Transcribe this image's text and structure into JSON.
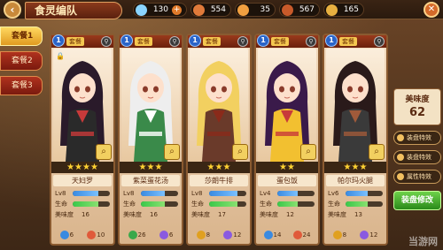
{
  "header": {
    "title": "食灵编队",
    "back_icon": "back-arrow-icon",
    "close_icon": "close-icon"
  },
  "resources": [
    {
      "icon": "diamond-icon",
      "value": "130",
      "color": "#8ad4ff",
      "has_plus": true
    },
    {
      "icon": "food-icon",
      "value": "554",
      "color": "#e07a3a",
      "has_plus": false
    },
    {
      "icon": "chicken-icon",
      "value": "35",
      "color": "#f2a040",
      "has_plus": false
    },
    {
      "icon": "drumstick-icon",
      "value": "567",
      "color": "#c85a2a",
      "has_plus": false
    },
    {
      "icon": "bread-icon",
      "value": "165",
      "color": "#e8b040",
      "has_plus": false
    }
  ],
  "tabs": [
    {
      "label": "套餐1",
      "active": true
    },
    {
      "label": "套餐2",
      "active": false
    },
    {
      "label": "套餐3",
      "active": false
    }
  ],
  "cards": [
    {
      "slot": "1",
      "tag": "套餐",
      "stars": "★★★★",
      "name": "天妇罗",
      "level": "Lv8",
      "hp_label": "生命",
      "taste_label": "美味度",
      "taste": "16",
      "hp_fill": 0.7,
      "icons": [
        {
          "v": "6",
          "c": "#3a8ae0"
        },
        {
          "v": "10",
          "c": "#e05a3a"
        }
      ],
      "hair": "#2a1a2a",
      "dress": "#2a2a2a",
      "accent": "#c83a3a",
      "locked": true
    },
    {
      "slot": "1",
      "tag": "套餐",
      "stars": "★★★",
      "name": "紫菜蛋花汤",
      "level": "Lv8",
      "hp_label": "生命",
      "taste_label": "美味度",
      "taste": "16",
      "hp_fill": 0.65,
      "icons": [
        {
          "v": "26",
          "c": "#3aa84a"
        },
        {
          "v": "6",
          "c": "#8a5ae0"
        }
      ],
      "hair": "#eeeeee",
      "dress": "#3a8a4a",
      "accent": "#ffffff",
      "locked": false
    },
    {
      "slot": "1",
      "tag": "套餐",
      "stars": "★★★",
      "name": "莎朗牛排",
      "level": "Lv8",
      "hp_label": "生命",
      "taste_label": "美味度",
      "taste": "17",
      "hp_fill": 0.75,
      "icons": [
        {
          "v": "8",
          "c": "#e0a020"
        },
        {
          "v": "12",
          "c": "#8a5ae0"
        }
      ],
      "hair": "#f2d060",
      "dress": "#6a3a2a",
      "accent": "#8a2a1a",
      "locked": false
    },
    {
      "slot": "1",
      "tag": "套餐",
      "stars": "★★",
      "name": "蛋包饭",
      "level": "Lv4",
      "hp_label": "生命",
      "taste_label": "美味度",
      "taste": "12",
      "hp_fill": 0.55,
      "icons": [
        {
          "v": "14",
          "c": "#3a8ae0"
        },
        {
          "v": "24",
          "c": "#e05a3a"
        }
      ],
      "hair": "#3a1a4a",
      "dress": "#f2c030",
      "accent": "#c83a3a",
      "locked": false
    },
    {
      "slot": "1",
      "tag": "套餐",
      "stars": "★★★",
      "name": "帕尔玛火腿",
      "level": "Lv6",
      "hp_label": "生命",
      "taste_label": "美味度",
      "taste": "13",
      "hp_fill": 0.6,
      "icons": [
        {
          "v": "8",
          "c": "#e0a020"
        },
        {
          "v": "12",
          "c": "#8a5ae0"
        }
      ],
      "hair": "#2a1a1a",
      "dress": "#3a3a3a",
      "accent": "#a05a3a",
      "locked": false
    }
  ],
  "right_panel": {
    "taste_label": "美味度",
    "taste_value": "62",
    "buttons": [
      "装盘特效",
      "装盘特效",
      "属性特效"
    ],
    "modify_label": "装盘修改"
  },
  "watermark": "当游网"
}
